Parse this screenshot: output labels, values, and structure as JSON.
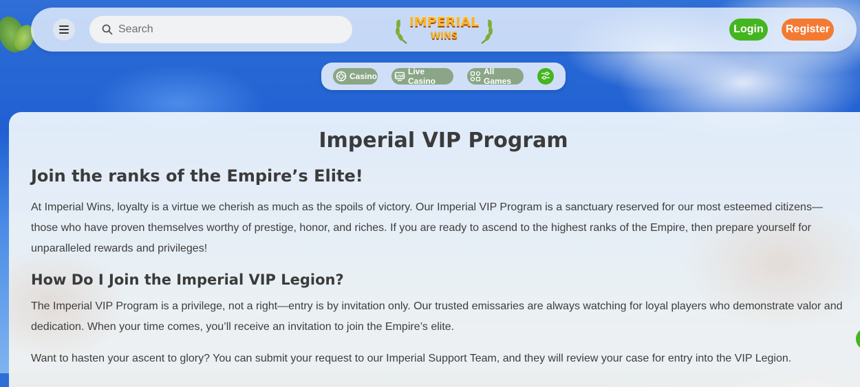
{
  "header": {
    "search": {
      "placeholder": "Search"
    },
    "logo": {
      "line1": "IMPERIAL",
      "line2": "WINS"
    },
    "login_label": "Login",
    "register_label": "Register"
  },
  "categories": [
    {
      "label": "Casino",
      "icon": "casino-chip-icon"
    },
    {
      "label": "Live Casino",
      "icon": "live-tv-icon"
    },
    {
      "label": "All Games",
      "icon": "grid-icon"
    }
  ],
  "content": {
    "title": "Imperial VIP Program",
    "subtitle": "Join the ranks of the Empire’s Elite!",
    "intro": "At Imperial Wins, loyalty is a virtue we cherish as much as the spoils of victory. Our Imperial VIP Program is a sanctuary reserved for our most esteemed citizens—those who have proven themselves worthy of prestige, honor, and riches. If you are ready to ascend to the highest ranks of the Empire, then prepare yourself for unparalleled rewards and privileges!",
    "section_heading": "How Do I Join the Imperial VIP Legion?",
    "section_p1": "The Imperial VIP Program is a privilege, not a right—entry is by invitation only. Our trusted emissaries are always watching for loyal players who demonstrate valor and dedication. When your time comes, you’ll receive an invitation to join the Empire’s elite.",
    "section_p2": "Want to hasten your ascent to glory? You can submit your request to our Imperial Support Team, and they will review your case for entry into the VIP Legion."
  },
  "colors": {
    "green": "#44b51f",
    "orange": "#f47a33",
    "chip": "#8aa686"
  }
}
